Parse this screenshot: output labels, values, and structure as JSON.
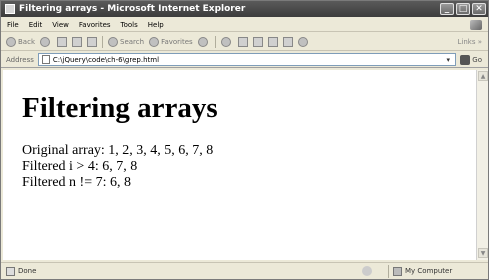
{
  "window": {
    "title": "Filtering arrays - Microsoft Internet Explorer",
    "controls": {
      "minimize": "_",
      "maximize": "□",
      "close": "✕"
    }
  },
  "menu": {
    "items": [
      "File",
      "Edit",
      "View",
      "Favorites",
      "Tools",
      "Help"
    ]
  },
  "toolbar": {
    "back_label": "Back",
    "search_label": "Search",
    "favorites_label": "Favorites",
    "links_label": "Links",
    "links_arrow": "»"
  },
  "address": {
    "label": "Address",
    "value": "C:\\jQuery\\code\\ch-6\\grep.html",
    "dropdown_arrow": "▾",
    "go_label": "Go"
  },
  "page": {
    "heading": "Filtering arrays",
    "lines": [
      "Original array: 1, 2, 3, 4, 5, 6, 7, 8",
      "Filtered i > 4: 6, 7, 8",
      "Filtered n != 7: 6, 8"
    ]
  },
  "status": {
    "text": "Done",
    "zone": "My Computer"
  },
  "icons": {
    "app": "ie-page-icon",
    "back": "back-arrow-icon",
    "forward": "forward-arrow-icon",
    "stop": "stop-icon",
    "refresh": "refresh-icon",
    "home": "home-icon",
    "search": "search-icon",
    "favorites": "favorites-star-icon",
    "media": "media-icon",
    "history": "history-icon",
    "mail": "mail-icon",
    "print": "print-icon",
    "edit": "edit-icon",
    "discuss": "discuss-icon",
    "messenger": "messenger-icon"
  }
}
